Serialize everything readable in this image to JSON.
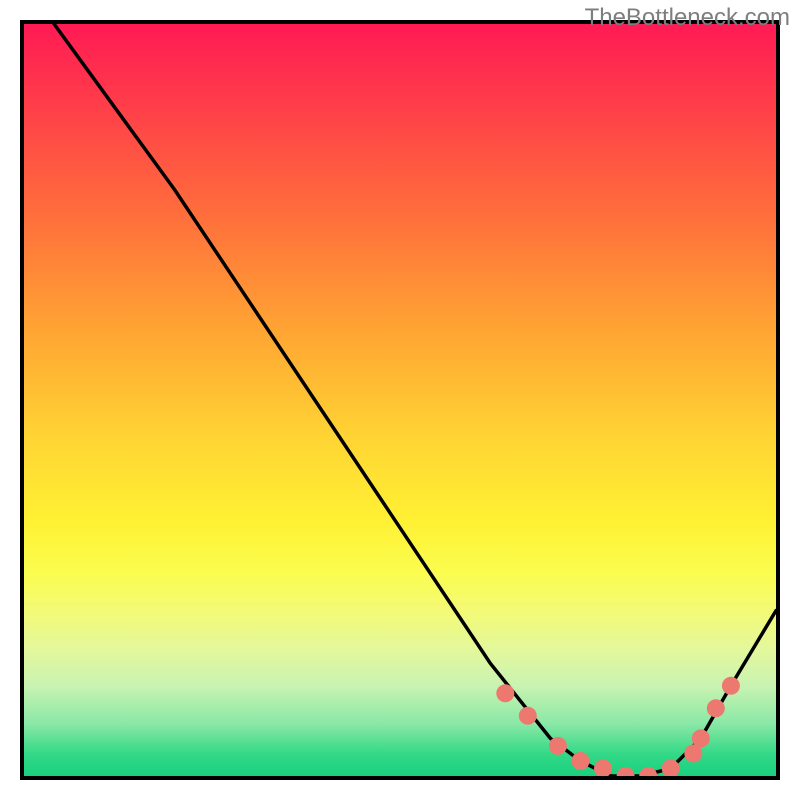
{
  "attribution": "TheBottleneck.com",
  "chart_data": {
    "type": "line",
    "title": "",
    "xlabel": "",
    "ylabel": "",
    "xlim": [
      0,
      100
    ],
    "ylim": [
      0,
      100
    ],
    "series": [
      {
        "name": "bottleneck-curve",
        "color": "#000000",
        "x": [
          4,
          12,
          20,
          30,
          40,
          50,
          58,
          62,
          66,
          70,
          74,
          78,
          82,
          86,
          90,
          94,
          100
        ],
        "y": [
          100,
          89,
          78,
          63,
          48,
          33,
          21,
          15,
          10,
          5,
          2,
          0,
          0,
          1,
          5,
          12,
          22
        ]
      }
    ],
    "markers": {
      "name": "dotted-zone",
      "color": "#ec786f",
      "x": [
        64,
        67,
        71,
        74,
        77,
        80,
        83,
        86,
        89,
        90,
        92,
        94
      ],
      "y": [
        11,
        8,
        4,
        2,
        1,
        0,
        0,
        1,
        3,
        5,
        9,
        12
      ]
    },
    "gradient_stops": [
      {
        "pos": 0.0,
        "color": "#ff1a54"
      },
      {
        "pos": 0.1,
        "color": "#ff3b4a"
      },
      {
        "pos": 0.25,
        "color": "#ff6d3c"
      },
      {
        "pos": 0.4,
        "color": "#ffa233"
      },
      {
        "pos": 0.55,
        "color": "#ffd433"
      },
      {
        "pos": 0.66,
        "color": "#fff133"
      },
      {
        "pos": 0.73,
        "color": "#fbfd4f"
      },
      {
        "pos": 0.78,
        "color": "#f3fa75"
      },
      {
        "pos": 0.83,
        "color": "#e4f89b"
      },
      {
        "pos": 0.88,
        "color": "#c9f3b2"
      },
      {
        "pos": 0.93,
        "color": "#8be8a6"
      },
      {
        "pos": 0.97,
        "color": "#34d987"
      },
      {
        "pos": 1.0,
        "color": "#19d07e"
      }
    ]
  }
}
